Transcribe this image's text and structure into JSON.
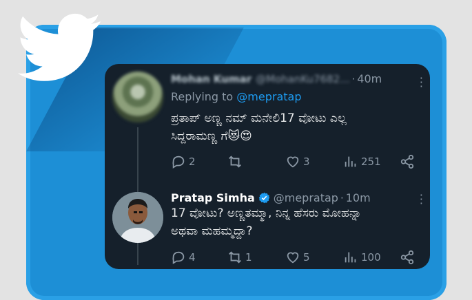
{
  "reply": {
    "author_name": "Mohan Kumar",
    "author_handle": "@MohanKu7682...",
    "time": "40m",
    "replying_prefix": "Replying to",
    "replying_handle": "@mepratap",
    "text_line1": "ಪ್ರತಾಪ್ ಅಣ್ಣ ನಮ್ ಮನೇಲಿ17 ವೋಟು ಎಲ್ಲ",
    "text_line2": "ಸಿದ್ದರಾಮಣ್ಣ ಗೆ😻😍",
    "replies": "2",
    "retweets": "",
    "likes": "3",
    "views": "251"
  },
  "main": {
    "author_name": "Pratap Simha",
    "author_handle": "@mepratap",
    "time": "10m",
    "text_line1": "17 ವೋಟು? ಅಣ್ಣತಮ್ಮಾ, ನಿನ್ನ ಹೆಸರು ಮೋಹನ್ನಾ",
    "text_line2": "ಅಥವಾ ಮಹಮ್ಮದ್ದಾ?",
    "replies": "4",
    "retweets": "1",
    "likes": "5",
    "views": "100"
  },
  "colors": {
    "accent": "#1d9bf0",
    "card_bg": "#15202b",
    "frame_blue": "#1d8fd6"
  },
  "icons": [
    "twitter-bird-icon",
    "reply-icon",
    "retweet-icon",
    "like-icon",
    "views-icon",
    "share-icon",
    "more-icon",
    "verified-badge-icon"
  ]
}
